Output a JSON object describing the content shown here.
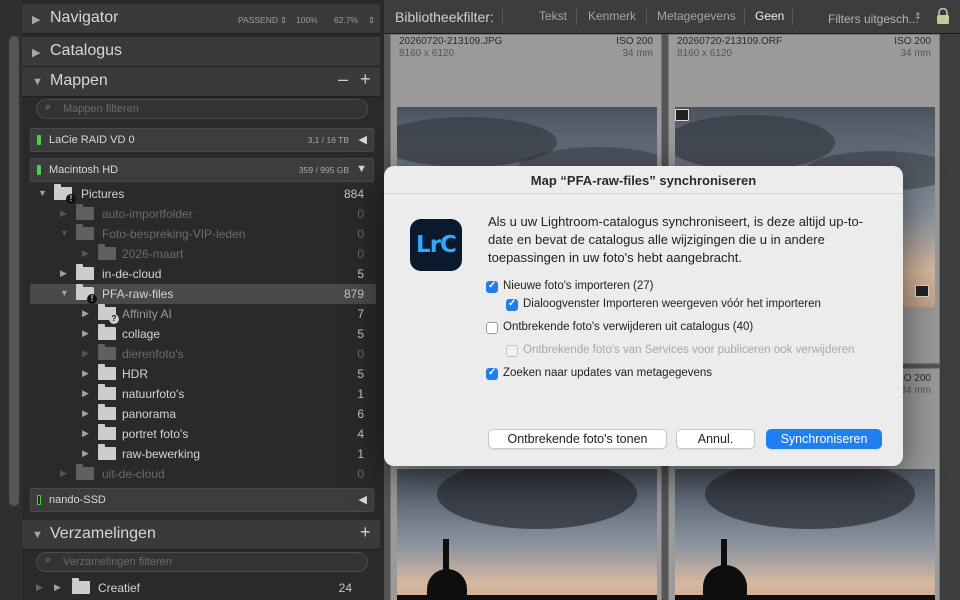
{
  "navigator": {
    "title": "Navigator",
    "zoom_options": [
      "PASSEND",
      "100%",
      "62.7%"
    ]
  },
  "catalogus": {
    "title": "Catalogus"
  },
  "mappen": {
    "title": "Mappen",
    "minus": "–",
    "plus": "+",
    "filter_placeholder": "Mappen filteren",
    "volumes": [
      {
        "name": "LaCie RAID VD 0",
        "size": "3,1 / 16 TB"
      },
      {
        "name": "Macintosh HD",
        "size": "359 / 995 GB"
      },
      {
        "name": "nando-SSD",
        "size": ""
      }
    ],
    "folders": [
      {
        "name": "Pictures",
        "count": "884"
      },
      {
        "name": "auto-importfolder",
        "count": "0"
      },
      {
        "name": "Foto-bespreking-VIP-leden",
        "count": "0"
      },
      {
        "name": "2026-maart",
        "count": "0"
      },
      {
        "name": "in-de-cloud",
        "count": "5"
      },
      {
        "name": "PFA-raw-files",
        "count": "879"
      },
      {
        "name": "Affinity AI",
        "count": "7"
      },
      {
        "name": "collage",
        "count": "5"
      },
      {
        "name": "dierenfoto's",
        "count": "0"
      },
      {
        "name": "HDR",
        "count": "5"
      },
      {
        "name": "natuurfoto's",
        "count": "1"
      },
      {
        "name": "panorama",
        "count": "6"
      },
      {
        "name": "portret foto's",
        "count": "4"
      },
      {
        "name": "raw-bewerking",
        "count": "1"
      },
      {
        "name": "uit-de-cloud",
        "count": "0"
      }
    ]
  },
  "verzamelingen": {
    "title": "Verzamelingen",
    "plus": "+",
    "filter_placeholder": "Verzamelingen filteren",
    "items": [
      {
        "name": "Creatief",
        "count": "24"
      }
    ]
  },
  "filter_bar": {
    "title": "Bibliotheekfilter:",
    "options": [
      "Tekst",
      "Kenmerk",
      "Metagegevens",
      "Geen"
    ],
    "active": "Geen",
    "preset": "Filters uitgesch..."
  },
  "grid": {
    "cells": [
      {
        "filename": "20260720-213109.JPG",
        "iso": "ISO 200",
        "dims": "8160 x 6120",
        "focal": "34 mm"
      },
      {
        "filename": "20260720-213109.ORF",
        "iso": "ISO 200",
        "dims": "8160 x 6120",
        "focal": "34 mm"
      }
    ],
    "partial_iso": "ISO 200",
    "partial_focal": "34 mm"
  },
  "dialog": {
    "title": "Map “PFA-raw-files” synchroniseren",
    "app_icon_text": "LrC",
    "message": "Als u uw Lightroom-catalogus synchroniseert, is deze altijd up-to-date en bevat de catalogus alle wijzigingen die u in andere toepassingen in uw foto's hebt aangebracht.",
    "options": [
      {
        "label": "Nieuwe foto's importeren (27)",
        "checked": true
      },
      {
        "label": "Dialoogvenster Importeren weergeven vóór het importeren",
        "checked": true
      },
      {
        "label": "Ontbrekende foto's verwijderen uit catalogus (40)",
        "checked": false
      },
      {
        "label": "Ontbrekende foto's van Services voor publiceren ook verwijderen",
        "checked": false,
        "disabled": true
      },
      {
        "label": "Zoeken naar updates van metagegevens",
        "checked": true
      }
    ],
    "buttons": {
      "show_missing": "Ontbrekende foto's tonen",
      "cancel": "Annul.",
      "sync": "Synchroniseren"
    }
  },
  "colors": {
    "accent": "#1f7ff0",
    "lrc_blue": "#31a8ff",
    "status_green": "#46d24a"
  }
}
